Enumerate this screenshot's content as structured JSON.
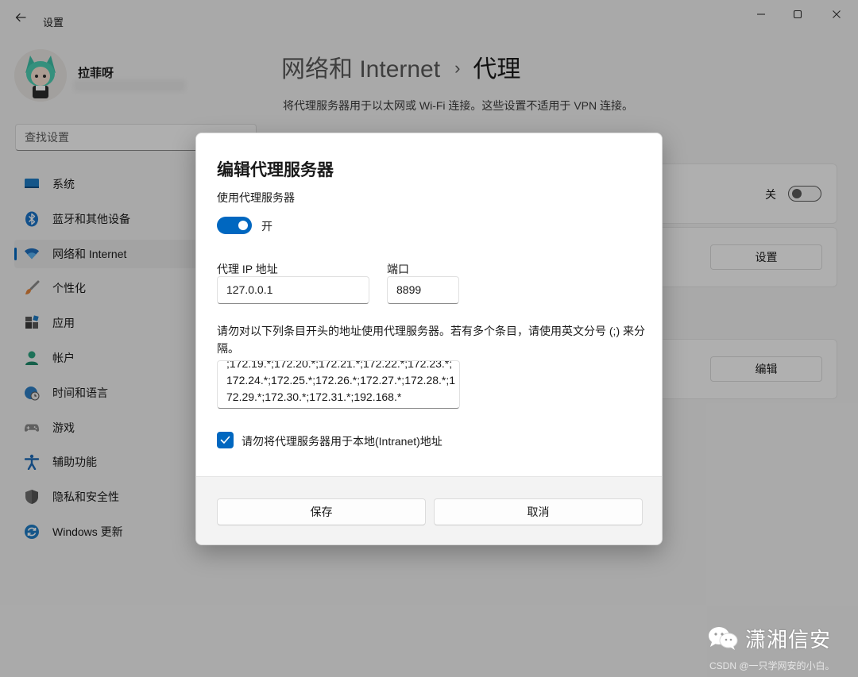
{
  "window": {
    "title": "设置",
    "controls": [
      "minimize-icon",
      "maximize-icon",
      "close-icon"
    ]
  },
  "profile": {
    "name": "拉菲呀"
  },
  "search": {
    "placeholder": "查找设置"
  },
  "sidebar": {
    "items": [
      {
        "label": "系统",
        "icon": "system-icon"
      },
      {
        "label": "蓝牙和其他设备",
        "icon": "bluetooth-icon"
      },
      {
        "label": "网络和 Internet",
        "icon": "wifi-icon",
        "active": true
      },
      {
        "label": "个性化",
        "icon": "brush-icon"
      },
      {
        "label": "应用",
        "icon": "apps-icon"
      },
      {
        "label": "帐户",
        "icon": "account-icon"
      },
      {
        "label": "时间和语言",
        "icon": "clock-globe-icon"
      },
      {
        "label": "游戏",
        "icon": "gamepad-icon"
      },
      {
        "label": "辅助功能",
        "icon": "accessibility-icon"
      },
      {
        "label": "隐私和安全性",
        "icon": "shield-icon"
      },
      {
        "label": "Windows 更新",
        "icon": "update-icon"
      }
    ]
  },
  "page": {
    "breadcrumb_parent": "网络和 Internet",
    "breadcrumb_separator": "›",
    "title": "代理",
    "subtitle": "将代理服务器用于以太网或 Wi-Fi 连接。这些设置不适用于 VPN 连接。"
  },
  "background_cards": {
    "auto_detect_state": "关",
    "setup_script_button": "设置",
    "manual_edit_button": "编辑"
  },
  "dialog": {
    "title": "编辑代理服务器",
    "use_proxy_label": "使用代理服务器",
    "use_proxy_state": "开",
    "use_proxy_on": true,
    "ip_label": "代理 IP 地址",
    "ip_value": "127.0.0.1",
    "port_label": "端口",
    "port_value": "8899",
    "exceptions_description": "请勿对以下列条目开头的地址使用代理服务器。若有多个条目，请使用英文分号 (;) 来分隔。",
    "exceptions_value": ";172.19.*;172.20.*;172.21.*;172.22.*;172.23.*;172.24.*;172.25.*;172.26.*;172.27.*;172.28.*;172.29.*;172.30.*;172.31.*;192.168.*",
    "bypass_local_label": "请勿将代理服务器用于本地(Intranet)地址",
    "bypass_local_checked": true,
    "save_button": "保存",
    "cancel_button": "取消"
  },
  "watermark": {
    "brand": "潇湘信安",
    "credit": "CSDN @一只学网安的小白。"
  },
  "colors": {
    "accent": "#0067c0",
    "window_bg": "#f3f3f3",
    "dialog_bg": "#ffffff"
  }
}
